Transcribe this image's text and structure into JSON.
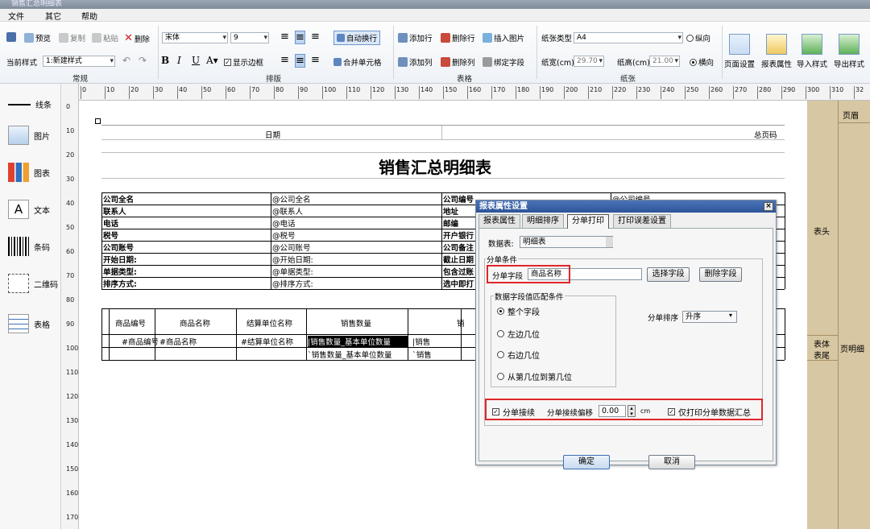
{
  "window": {
    "title": "销售汇总明细表"
  },
  "menu": [
    "文件",
    "其它",
    "帮助"
  ],
  "ribbon": {
    "row1": {
      "save": "",
      "preview": "预览",
      "copy": "复制",
      "paste": "粘贴",
      "delete": "删除",
      "font": "宋体",
      "fontsize": "9",
      "autowrap": "自动换行",
      "add_row": "添加行",
      "del_row": "删除行",
      "insert_image": "插入图片",
      "paper_type_label": "纸张类型",
      "paper_type": "A4",
      "portrait": "纵向"
    },
    "row2": {
      "current_style_label": "当前样式",
      "current_style": "1:新建样式",
      "show_border": "显示边框",
      "merge_cells": "合并单元格",
      "add_col": "添加列",
      "del_col": "删除列",
      "bind_field": "绑定字段",
      "paper_width_label": "纸宽(cm)",
      "paper_width": "29.70",
      "paper_height_label": "纸高(cm)",
      "paper_height": "21.00",
      "landscape": "横向"
    },
    "groups": [
      "常规",
      "排版",
      "表格",
      "纸张"
    ],
    "big_buttons": [
      "页面设置",
      "报表属性",
      "导入样式",
      "导出样式"
    ]
  },
  "ruler": {
    "h": [
      "0",
      "10",
      "20",
      "30",
      "40",
      "50",
      "60",
      "70",
      "80",
      "90",
      "100",
      "110",
      "120",
      "130",
      "140",
      "150",
      "160",
      "170",
      "180",
      "190",
      "200",
      "210",
      "220",
      "230",
      "240",
      "250",
      "260",
      "270",
      "280",
      "290",
      "300",
      "310",
      "32"
    ],
    "v": [
      "0",
      "10",
      "20",
      "30",
      "40",
      "50",
      "60",
      "70",
      "80",
      "90",
      "100",
      "110",
      "120",
      "130",
      "140",
      "150",
      "160",
      "170"
    ]
  },
  "toolbox": [
    "线条",
    "图片",
    "图表",
    "文本",
    "条码",
    "二维码",
    "表格"
  ],
  "bands": {
    "header": "页眉",
    "table_head": "表头",
    "body": "表体",
    "tail": "表尾",
    "detail": "页明细"
  },
  "report": {
    "date_label": "日期",
    "page_label": "总页码",
    "title": "销售汇总明细表",
    "info_rows": [
      {
        "l": "公司全名",
        "v": "@公司全名",
        "r": "公司编号",
        "rv": "@公司编号"
      },
      {
        "l": "联系人",
        "v": "@联系人",
        "r": "地址",
        "rv": ""
      },
      {
        "l": "电话",
        "v": "@电话",
        "r": "邮编",
        "rv": ""
      },
      {
        "l": "税号",
        "v": "@税号",
        "r": "开户银行",
        "rv": ""
      },
      {
        "l": "公司账号",
        "v": "@公司账号",
        "r": "公司备注",
        "rv": ""
      },
      {
        "l": "开始日期:",
        "v": "@开始日期:",
        "r": "截止日期",
        "rv": ""
      },
      {
        "l": "单据类型:",
        "v": "@单据类型:",
        "r": "包含过账",
        "rv": ""
      },
      {
        "l": "排序方式:",
        "v": "@排序方式:",
        "r": "选中即打",
        "rv": ""
      }
    ],
    "detail_headers": [
      "商品编号",
      "商品名称",
      "结算单位名称",
      "销售数量",
      "销"
    ],
    "detail_row": [
      "#商品编号",
      "#商品名称",
      "#结算单位名称",
      "|销售数量_基本单位数量",
      "|销售"
    ],
    "sum_row": [
      "",
      "",
      "",
      "`销售数量_基本单位数量",
      "`销售"
    ]
  },
  "dialog": {
    "title": "报表属性设置",
    "tabs": [
      "报表属性",
      "明细排序",
      "分单打印",
      "打印误差设置"
    ],
    "datatable_label": "数据表:",
    "datatable": "明细表",
    "split_condition": "分单条件",
    "split_field_label": "分单字段",
    "split_field": "商品名称",
    "select_field": "选择字段",
    "delete_field": "删除字段",
    "match_group": "数据字段值匹配条件",
    "match_options": [
      "整个字段",
      "左边几位",
      "右边几位",
      "从第几位到第几位"
    ],
    "sort_label": "分单排序",
    "sort_value": "升序",
    "continue_label": "分单接续",
    "offset_label": "分单接续偏移",
    "offset_value": "0.00",
    "offset_unit": "cm",
    "print_summary_label": "仅打印分单数据汇总",
    "ok": "确定",
    "cancel": "取消"
  },
  "colors": {
    "accent_red": "#e0262a",
    "dialog_title": "#2d5499",
    "band": "#d8c7a3"
  }
}
